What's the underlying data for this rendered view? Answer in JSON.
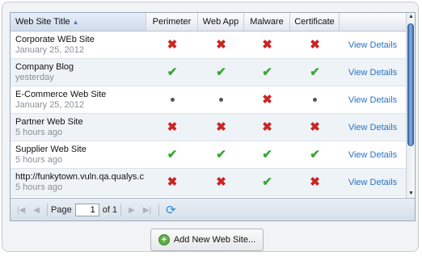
{
  "columns": [
    {
      "label": "Web Site Title"
    },
    {
      "label": "Perimeter"
    },
    {
      "label": "Web App"
    },
    {
      "label": "Malware"
    },
    {
      "label": "Certificate"
    },
    {
      "label": ""
    }
  ],
  "rows": [
    {
      "name": "Corporate WEb Site",
      "time": "January 25, 2012",
      "perimeter": "fail",
      "webapp": "fail",
      "malware": "fail",
      "certificate": "fail",
      "action": "View Details"
    },
    {
      "name": "Company Blog",
      "time": "yesterday",
      "perimeter": "pass",
      "webapp": "pass",
      "malware": "pass",
      "certificate": "pass",
      "action": "View Details"
    },
    {
      "name": "E-Commerce Web Site",
      "time": "January 25, 2012",
      "perimeter": "none",
      "webapp": "none",
      "malware": "fail",
      "certificate": "none",
      "action": "View Details"
    },
    {
      "name": "Partner Web Site",
      "time": "5 hours ago",
      "perimeter": "fail",
      "webapp": "fail",
      "malware": "fail",
      "certificate": "fail",
      "action": "View Details"
    },
    {
      "name": "Supplier Web Site",
      "time": "5 hours ago",
      "perimeter": "pass",
      "webapp": "pass",
      "malware": "pass",
      "certificate": "pass",
      "action": "View Details"
    },
    {
      "name": "http://funkytown.vuln.qa.qualys.c",
      "time": "5 hours ago",
      "perimeter": "fail",
      "webapp": "fail",
      "malware": "pass",
      "certificate": "fail",
      "action": "View Details"
    }
  ],
  "pager": {
    "page_label": "Page",
    "page_value": "1",
    "of_label": "of 1"
  },
  "add_button": {
    "label": "Add New Web Site..."
  },
  "icons": {
    "pass": "check-icon",
    "fail": "x-icon",
    "none": "dot-icon"
  },
  "colors": {
    "pass": "#3aa632",
    "fail": "#cc2424",
    "link": "#2a73c2"
  }
}
